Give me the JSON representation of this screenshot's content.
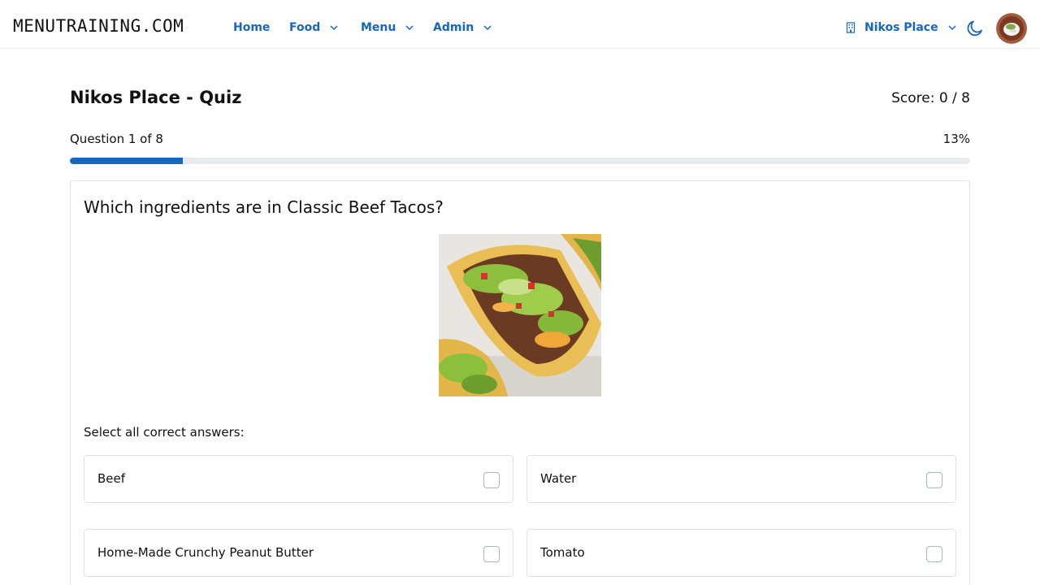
{
  "nav": {
    "logo": "MENUTRAINING.COM",
    "links": [
      {
        "label": "Home"
      },
      {
        "label": "Food"
      },
      {
        "label": "Menu"
      },
      {
        "label": "Admin"
      }
    ],
    "restaurant": "Nikos Place"
  },
  "quiz": {
    "title": "Nikos Place - Quiz",
    "score": "Score: 0 / 8",
    "progress_label": "Question 1 of 8",
    "percent_label": "13%",
    "progress_fraction": 0.125
  },
  "question": {
    "text": "Which ingredients are in Classic Beef Tacos?",
    "instruction": "Select all correct answers:",
    "answers": [
      {
        "label": "Beef"
      },
      {
        "label": "Water"
      },
      {
        "label": "Home-Made Crunchy Peanut Butter"
      },
      {
        "label": "Tomato"
      }
    ]
  },
  "colors": {
    "accent": "#1766c2",
    "track": "#e9ecef"
  }
}
